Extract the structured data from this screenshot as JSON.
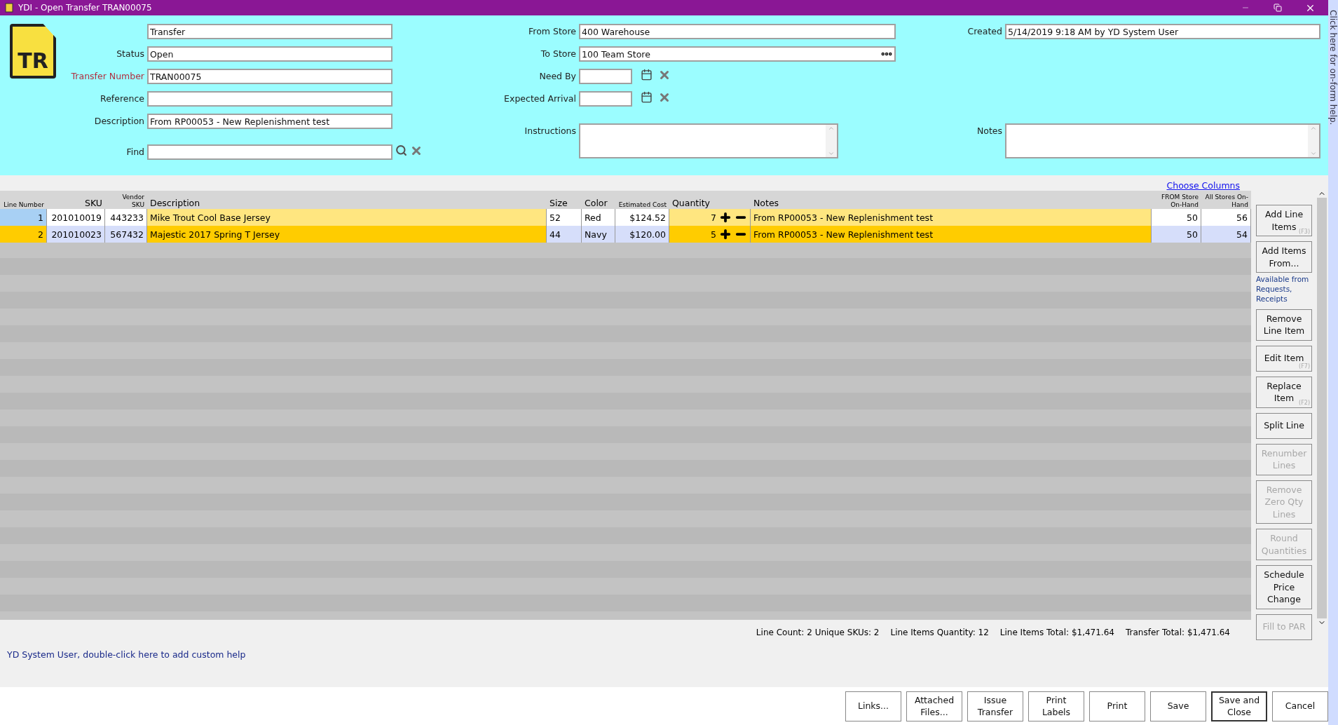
{
  "window": {
    "title": "YDI - Open Transfer TRAN00075"
  },
  "logo": {
    "text": "TR"
  },
  "form": {
    "left": [
      {
        "value": "Transfer"
      },
      {
        "label": "Status",
        "value": "Open",
        "required": false
      },
      {
        "label": "Transfer Number",
        "value": "TRAN00075",
        "required": true
      },
      {
        "label": "Reference",
        "required": false
      },
      {
        "label": "Description",
        "value": "From RP00053 - New Replenishment test",
        "required": false
      }
    ],
    "find": {
      "label": "Find"
    },
    "from_store": {
      "label": "From Store",
      "value": "400 Warehouse"
    },
    "to_store": {
      "label": "To Store",
      "value": "100 Team Store"
    },
    "dates": [
      {
        "label": "Need By"
      },
      {
        "label": "Expected Arrival"
      }
    ],
    "instructions": {
      "label": "Instructions"
    },
    "created": {
      "label": "Created",
      "value": "5/14/2019 9:18 AM by YD System User"
    },
    "notes": {
      "label": "Notes"
    }
  },
  "help_strip": {
    "text": "Click here for on-form help."
  },
  "choose_columns": "Choose Columns",
  "table": {
    "columns": [
      {
        "label": "Line Number",
        "small": true
      },
      {
        "label": "SKU",
        "small": false
      },
      {
        "label": "Vendor SKU",
        "small": true
      },
      {
        "label": "Description",
        "small": false
      },
      {
        "label": "Size",
        "small": false
      },
      {
        "label": "Color",
        "small": false
      },
      {
        "label": "Estimated Cost",
        "small": true
      },
      {
        "label": "Quantity",
        "small": false
      },
      {
        "label": "Notes",
        "small": false
      },
      {
        "label": "FROM Store On-Hand",
        "small": true
      },
      {
        "label": "All Stores On-Hand",
        "small": true
      }
    ],
    "rows": [
      {
        "selected": true,
        "cells": [
          "1",
          "201010019",
          "443233",
          "Mike Trout Cool Base Jersey",
          "52",
          "Red",
          "$124.52",
          "7",
          "From RP00053 - New Replenishment test",
          "50",
          "56"
        ]
      },
      {
        "selected": false,
        "cells": [
          "2",
          "201010023",
          "567432",
          "Majestic 2017 Spring T Jersey",
          "44",
          "Navy",
          "$120.00",
          "5",
          "From RP00053 - New Replenishment test",
          "50",
          "54"
        ]
      }
    ]
  },
  "side_buttons": [
    {
      "label": "Add Line Items",
      "hotkey": "(F3)",
      "disabled": false
    },
    {
      "label": "Add Items From...",
      "disabled": false,
      "note": "Available from Requests, Receipts"
    },
    {
      "label": "Remove Line Item",
      "disabled": false
    },
    {
      "label": "Edit Item",
      "hotkey": "(F7)",
      "disabled": false
    },
    {
      "label": "Replace Item",
      "hotkey": "(F2)",
      "disabled": false
    },
    {
      "label": "Split Line",
      "disabled": false
    },
    {
      "label": "Renumber Lines",
      "disabled": true
    },
    {
      "label": "Remove Zero Qty Lines",
      "disabled": true
    },
    {
      "label": "Round Quantities",
      "disabled": true
    },
    {
      "label": "Schedule Price Change",
      "disabled": false
    },
    {
      "label": "Fill to PAR",
      "disabled": true
    }
  ],
  "totals": [
    "Line Count: 2 Unique SKUs: 2",
    "Line Items Quantity: 12",
    "Line Items Total: $1,471.64",
    "Transfer Total: $1,471.64"
  ],
  "custom_help": "YD System User, double-click here to add custom help",
  "bottom_buttons": [
    {
      "label": "Links...",
      "default": false
    },
    {
      "label": "Attached Files...",
      "default": false
    },
    {
      "label": "Issue Transfer",
      "default": false
    },
    {
      "label": "Print Labels",
      "default": false
    },
    {
      "label": "Print",
      "default": false
    },
    {
      "label": "Save",
      "default": false
    },
    {
      "label": "Save and Close",
      "default": true
    },
    {
      "label": "Cancel",
      "default": false
    }
  ]
}
